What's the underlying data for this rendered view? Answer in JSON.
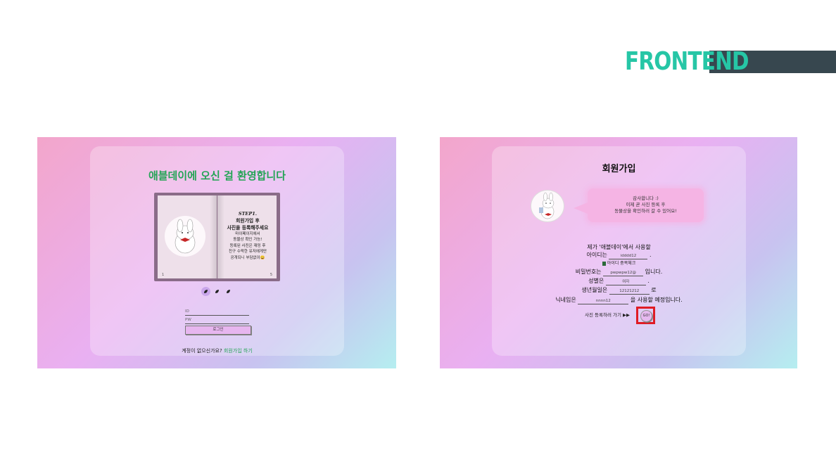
{
  "header": {
    "title": "FRONTEND"
  },
  "left_screen": {
    "welcome": "애블데이에 오신 걸 환영합니다",
    "book": {
      "step_label": "STEP1.",
      "heading_line1": "회원가입 후",
      "heading_line2": "사진을 등록해주세요",
      "lines": [
        "마이페이지에서",
        "동물상 확인 가능!",
        "등록된 사진은 재밍 후",
        "친구 수락한 유저에게만",
        "공개되니 부담없이😄"
      ],
      "page_left": "1",
      "page_right": "5"
    },
    "id_label": "ID",
    "pw_label": "PW",
    "login_button": "로그인",
    "signup_prompt": "계정이 없으신가요?",
    "signup_link": "회원가입 하기"
  },
  "right_screen": {
    "title": "회원가입",
    "bubble_lines": [
      "감사합니다 :)",
      "이제 곧 사진 등록 후",
      "동물상을 확인하러 갈 수 있어요!"
    ],
    "intro": "제가 '애블데이'에서 사용할",
    "id_prefix": "아이디는",
    "id_value": "idddd12",
    "dup_check": "아이디 중복체크",
    "pw_prefix": "비밀번호는",
    "pw_value": "pwpwpw12@",
    "pw_suffix": "입니다.",
    "gender_prefix": "성별은",
    "gender_value": "여자",
    "birth_prefix": "생년월일은",
    "birth_value": "12121212",
    "birth_suffix": "로",
    "nick_prefix": "닉네임은",
    "nick_value": "nnnn12",
    "nick_suffix": "을 사용할 예정입니다.",
    "go_label": "사진 등록하러 가기 ▶▶",
    "go_button": "GO!"
  },
  "colors": {
    "accent_green": "#23a455",
    "header_teal": "#26c6a6",
    "header_bar": "#37474f",
    "highlight_red": "#e01b24"
  }
}
